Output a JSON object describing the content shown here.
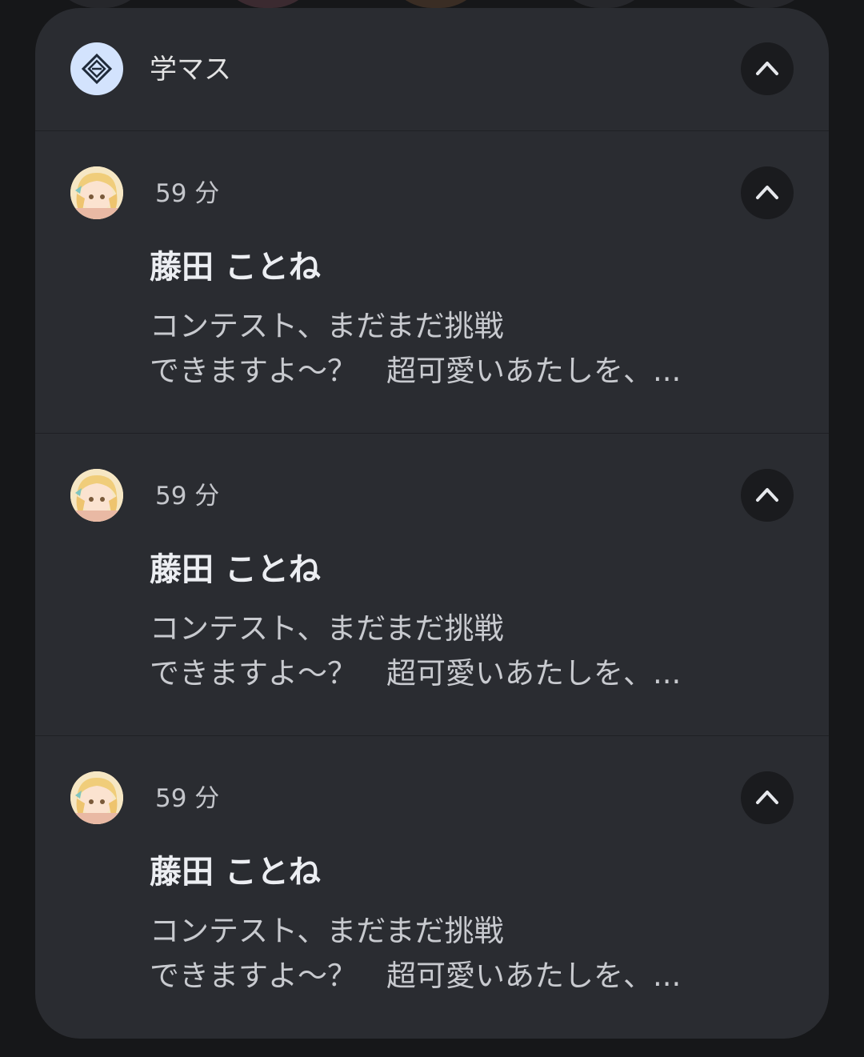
{
  "group": {
    "app_name": "学マス",
    "app_icon": "gakumasu-app-icon",
    "expand_icon": "chevron-up-icon"
  },
  "notifications": [
    {
      "time": "59 分",
      "sender": "藤田 ことね",
      "line1": "コンテスト、まだまだ挑戦",
      "line2": "できますよ〜？　超可愛いあたしを、...",
      "avatar": "character-avatar",
      "expand_icon": "chevron-up-icon"
    },
    {
      "time": "59 分",
      "sender": "藤田 ことね",
      "line1": "コンテスト、まだまだ挑戦",
      "line2": "できますよ〜？　超可愛いあたしを、...",
      "avatar": "character-avatar",
      "expand_icon": "chevron-up-icon"
    },
    {
      "time": "59 分",
      "sender": "藤田 ことね",
      "line1": "コンテスト、まだまだ挑戦",
      "line2": "できますよ〜？　超可愛いあたしを、...",
      "avatar": "character-avatar",
      "expand_icon": "chevron-up-icon"
    }
  ],
  "colors": {
    "panel": "#2a2c31",
    "button": "#1a1b1e",
    "app_icon_bg": "#d3e3fd"
  }
}
